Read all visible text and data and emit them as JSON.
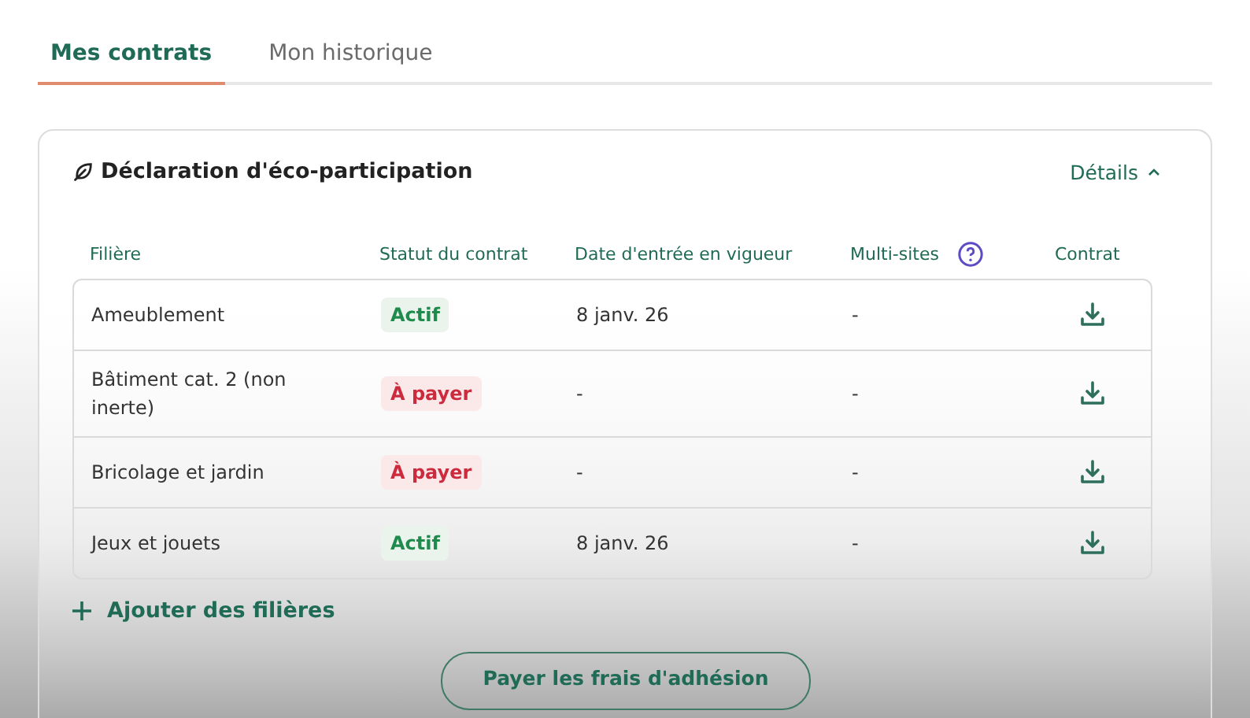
{
  "tabs": [
    {
      "label": "Mes contrats",
      "selected": true
    },
    {
      "label": "Mon historique",
      "selected": false
    }
  ],
  "card": {
    "title": "Déclaration d'éco-participation",
    "details": {
      "label": "Détails",
      "expanded": true
    },
    "table": {
      "columns": [
        "Filière",
        "Statut du contrat",
        "Date d'entrée en vigueur",
        "Multi-sites",
        "Contrat"
      ],
      "rows": [
        {
          "filiere": "Ameublement",
          "status": {
            "label": "Actif",
            "kind": "active"
          },
          "date": "8 janv. 26",
          "multi": "-"
        },
        {
          "filiere": "Bâtiment cat. 2 (non inerte)",
          "status": {
            "label": "À payer",
            "kind": "due"
          },
          "date": "-",
          "multi": "-"
        },
        {
          "filiere": "Bricolage et jardin",
          "status": {
            "label": "À payer",
            "kind": "due"
          },
          "date": "-",
          "multi": "-"
        },
        {
          "filiere": "Jeux et jouets",
          "status": {
            "label": "Actif",
            "kind": "active"
          },
          "date": "8 janv. 26",
          "multi": "-"
        }
      ]
    },
    "add_link": "Ajouter des filières",
    "pay_button": "Payer les frais d'adhésion"
  }
}
